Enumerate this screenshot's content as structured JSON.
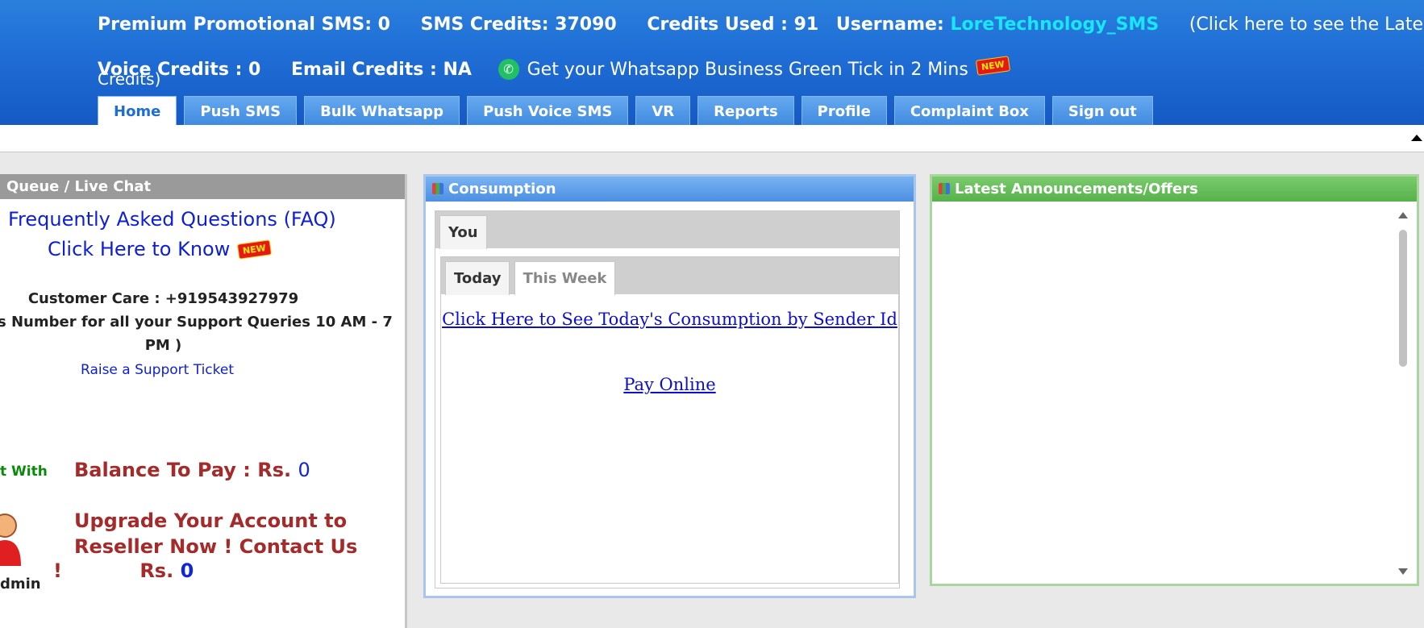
{
  "header": {
    "premium_sms": "Premium Promotional SMS: 0",
    "sms_credits": "SMS Credits: 37090",
    "credits_used": "Credits Used : 91",
    "username_label": "Username:",
    "username": "LoreTechnology_SMS",
    "latest_credits": "(Click here to see the Latest",
    "latest_credits_tail": "Credits)",
    "voice_credits": "Voice Credits : 0",
    "email_credits": "Email Credits : NA",
    "whatsapp_promo": "Get your Whatsapp Business Green Tick in 2 Mins",
    "new_badge": "NEW"
  },
  "nav": {
    "tabs": [
      "Home",
      "Push SMS",
      "Bulk Whatsapp",
      "Push Voice SMS",
      "VR",
      "Reports",
      "Profile",
      "Complaint Box",
      "Sign out"
    ]
  },
  "left_panel": {
    "title": "Queue / Live Chat",
    "faq": "Frequently Asked Questions (FAQ)",
    "know": "Click Here to Know",
    "customer_care": "Customer Care : +919543927979",
    "support_line1": "s Number for all your Support Queries 10 AM - 7",
    "support_line2": "PM )",
    "raise_ticket": "Raise a Support Ticket",
    "chat_with": "t With",
    "balance_label": "Balance To Pay :  Rs.",
    "balance_value": "0",
    "upgrade": "Upgrade Your Account to Reseller Now ! Contact Us",
    "upgrade_tail_pre": "!",
    "upgrade_rs": "Rs.",
    "upgrade_value": "0",
    "admin": "dmin"
  },
  "consumption": {
    "title": "Consumption",
    "outer_tab": "You",
    "inner_tabs": [
      "Today",
      "This Week"
    ],
    "link_sender": "Click Here to See Today's Consumption by Sender Id",
    "pay_online": "Pay Online"
  },
  "announcements": {
    "title": "Latest Announcements/Offers"
  },
  "colors": {
    "header_blue": "#1f6fd6",
    "username_cyan": "#19e6ff",
    "link_blue": "#0d1fd6",
    "maroon": "#a52a2a",
    "green_header": "#56b24a"
  }
}
